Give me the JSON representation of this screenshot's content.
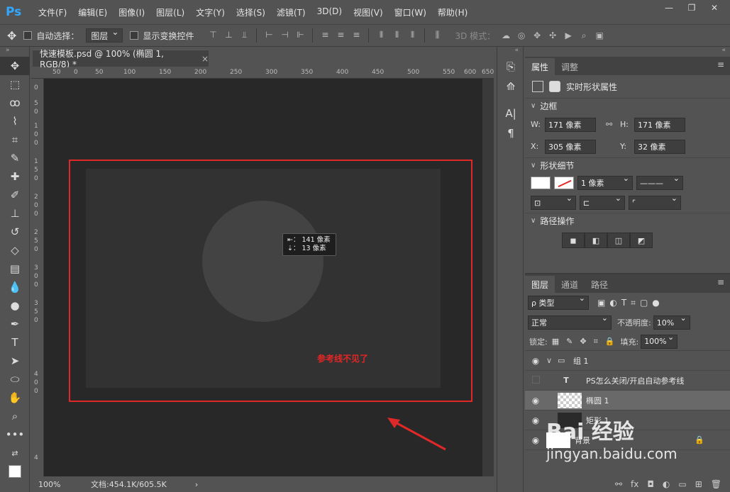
{
  "app": {
    "logo": "Ps"
  },
  "menu": [
    "文件(F)",
    "编辑(E)",
    "图像(I)",
    "图层(L)",
    "文字(Y)",
    "选择(S)",
    "滤镜(T)",
    "3D(D)",
    "视图(V)",
    "窗口(W)",
    "帮助(H)"
  ],
  "window_controls": {
    "minimize": "—",
    "restore": "❐",
    "close": "✕"
  },
  "options": {
    "auto_select": "自动选择：",
    "auto_select_target": "图层",
    "show_transform": "显示变换控件",
    "mode_3d": "3D 模式："
  },
  "document": {
    "tab_title": "快速模板.psd @ 100% (椭圆 1, RGB/8) *",
    "close_icon": "×",
    "zoom": "100%",
    "doc_size": "文档:454.1K/605.5K",
    "ruler_h": [
      "50",
      "0",
      "50",
      "100",
      "150",
      "200",
      "250",
      "300",
      "350",
      "400",
      "450",
      "500",
      "550",
      "600",
      "650"
    ],
    "ruler_v": [
      "0",
      "5",
      "0",
      "1",
      "0",
      "0",
      "1",
      "5",
      "0",
      "2",
      "0",
      "0",
      "2",
      "5",
      "0",
      "3",
      "0",
      "0",
      "3",
      "5",
      "0",
      "4",
      "0",
      "0",
      "4"
    ]
  },
  "tooltip": {
    "line1": "⇤： 141 像素",
    "line2": "⇣：  13 像素"
  },
  "annotation": "参考线不见了",
  "annotation_color": "#e32626",
  "properties": {
    "tabs": [
      "属性",
      "调整"
    ],
    "header": "实时形状属性",
    "section_frame": "边框",
    "w_label": "W:",
    "w_value": "171 像素",
    "h_label": "H:",
    "h_value": "171 像素",
    "x_label": "X:",
    "x_value": "305 像素",
    "y_label": "Y:",
    "y_value": "32 像素",
    "section_shape": "形状细节",
    "stroke_width": "1 像素",
    "section_path": "路径操作"
  },
  "layers": {
    "tabs": [
      "图层",
      "通道",
      "路径"
    ],
    "filter": "ρ 类型",
    "blend_mode": "正常",
    "opacity_label": "不透明度:",
    "opacity_value": "10%",
    "lock_label": "锁定:",
    "fill_label": "填充:",
    "fill_value": "100%",
    "items": [
      {
        "name": "组 1"
      },
      {
        "name": "PS怎么关闭/开启自动参考线"
      },
      {
        "name": "椭圆 1"
      },
      {
        "name": "矩形 1"
      },
      {
        "name": "背景"
      }
    ]
  },
  "watermark": {
    "logo": "Bai 经验",
    "url": "jingyan.baidu.com"
  }
}
